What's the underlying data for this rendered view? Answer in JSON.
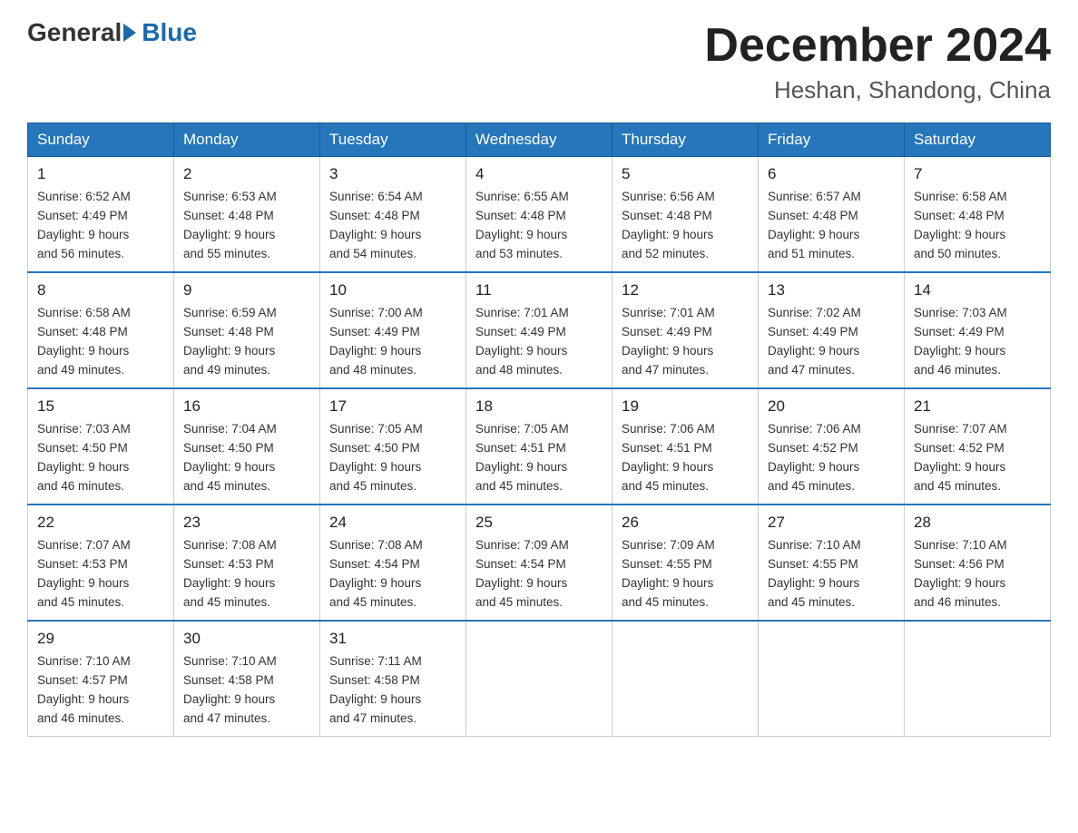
{
  "logo": {
    "general": "General",
    "blue": "Blue"
  },
  "title": "December 2024",
  "location": "Heshan, Shandong, China",
  "days_of_week": [
    "Sunday",
    "Monday",
    "Tuesday",
    "Wednesday",
    "Thursday",
    "Friday",
    "Saturday"
  ],
  "weeks": [
    [
      {
        "day": "1",
        "sunrise": "6:52 AM",
        "sunset": "4:49 PM",
        "daylight": "9 hours and 56 minutes."
      },
      {
        "day": "2",
        "sunrise": "6:53 AM",
        "sunset": "4:48 PM",
        "daylight": "9 hours and 55 minutes."
      },
      {
        "day": "3",
        "sunrise": "6:54 AM",
        "sunset": "4:48 PM",
        "daylight": "9 hours and 54 minutes."
      },
      {
        "day": "4",
        "sunrise": "6:55 AM",
        "sunset": "4:48 PM",
        "daylight": "9 hours and 53 minutes."
      },
      {
        "day": "5",
        "sunrise": "6:56 AM",
        "sunset": "4:48 PM",
        "daylight": "9 hours and 52 minutes."
      },
      {
        "day": "6",
        "sunrise": "6:57 AM",
        "sunset": "4:48 PM",
        "daylight": "9 hours and 51 minutes."
      },
      {
        "day": "7",
        "sunrise": "6:58 AM",
        "sunset": "4:48 PM",
        "daylight": "9 hours and 50 minutes."
      }
    ],
    [
      {
        "day": "8",
        "sunrise": "6:58 AM",
        "sunset": "4:48 PM",
        "daylight": "9 hours and 49 minutes."
      },
      {
        "day": "9",
        "sunrise": "6:59 AM",
        "sunset": "4:48 PM",
        "daylight": "9 hours and 49 minutes."
      },
      {
        "day": "10",
        "sunrise": "7:00 AM",
        "sunset": "4:49 PM",
        "daylight": "9 hours and 48 minutes."
      },
      {
        "day": "11",
        "sunrise": "7:01 AM",
        "sunset": "4:49 PM",
        "daylight": "9 hours and 48 minutes."
      },
      {
        "day": "12",
        "sunrise": "7:01 AM",
        "sunset": "4:49 PM",
        "daylight": "9 hours and 47 minutes."
      },
      {
        "day": "13",
        "sunrise": "7:02 AM",
        "sunset": "4:49 PM",
        "daylight": "9 hours and 47 minutes."
      },
      {
        "day": "14",
        "sunrise": "7:03 AM",
        "sunset": "4:49 PM",
        "daylight": "9 hours and 46 minutes."
      }
    ],
    [
      {
        "day": "15",
        "sunrise": "7:03 AM",
        "sunset": "4:50 PM",
        "daylight": "9 hours and 46 minutes."
      },
      {
        "day": "16",
        "sunrise": "7:04 AM",
        "sunset": "4:50 PM",
        "daylight": "9 hours and 45 minutes."
      },
      {
        "day": "17",
        "sunrise": "7:05 AM",
        "sunset": "4:50 PM",
        "daylight": "9 hours and 45 minutes."
      },
      {
        "day": "18",
        "sunrise": "7:05 AM",
        "sunset": "4:51 PM",
        "daylight": "9 hours and 45 minutes."
      },
      {
        "day": "19",
        "sunrise": "7:06 AM",
        "sunset": "4:51 PM",
        "daylight": "9 hours and 45 minutes."
      },
      {
        "day": "20",
        "sunrise": "7:06 AM",
        "sunset": "4:52 PM",
        "daylight": "9 hours and 45 minutes."
      },
      {
        "day": "21",
        "sunrise": "7:07 AM",
        "sunset": "4:52 PM",
        "daylight": "9 hours and 45 minutes."
      }
    ],
    [
      {
        "day": "22",
        "sunrise": "7:07 AM",
        "sunset": "4:53 PM",
        "daylight": "9 hours and 45 minutes."
      },
      {
        "day": "23",
        "sunrise": "7:08 AM",
        "sunset": "4:53 PM",
        "daylight": "9 hours and 45 minutes."
      },
      {
        "day": "24",
        "sunrise": "7:08 AM",
        "sunset": "4:54 PM",
        "daylight": "9 hours and 45 minutes."
      },
      {
        "day": "25",
        "sunrise": "7:09 AM",
        "sunset": "4:54 PM",
        "daylight": "9 hours and 45 minutes."
      },
      {
        "day": "26",
        "sunrise": "7:09 AM",
        "sunset": "4:55 PM",
        "daylight": "9 hours and 45 minutes."
      },
      {
        "day": "27",
        "sunrise": "7:10 AM",
        "sunset": "4:55 PM",
        "daylight": "9 hours and 45 minutes."
      },
      {
        "day": "28",
        "sunrise": "7:10 AM",
        "sunset": "4:56 PM",
        "daylight": "9 hours and 46 minutes."
      }
    ],
    [
      {
        "day": "29",
        "sunrise": "7:10 AM",
        "sunset": "4:57 PM",
        "daylight": "9 hours and 46 minutes."
      },
      {
        "day": "30",
        "sunrise": "7:10 AM",
        "sunset": "4:58 PM",
        "daylight": "9 hours and 47 minutes."
      },
      {
        "day": "31",
        "sunrise": "7:11 AM",
        "sunset": "4:58 PM",
        "daylight": "9 hours and 47 minutes."
      },
      null,
      null,
      null,
      null
    ]
  ],
  "labels": {
    "sunrise": "Sunrise:",
    "sunset": "Sunset:",
    "daylight": "Daylight:"
  }
}
